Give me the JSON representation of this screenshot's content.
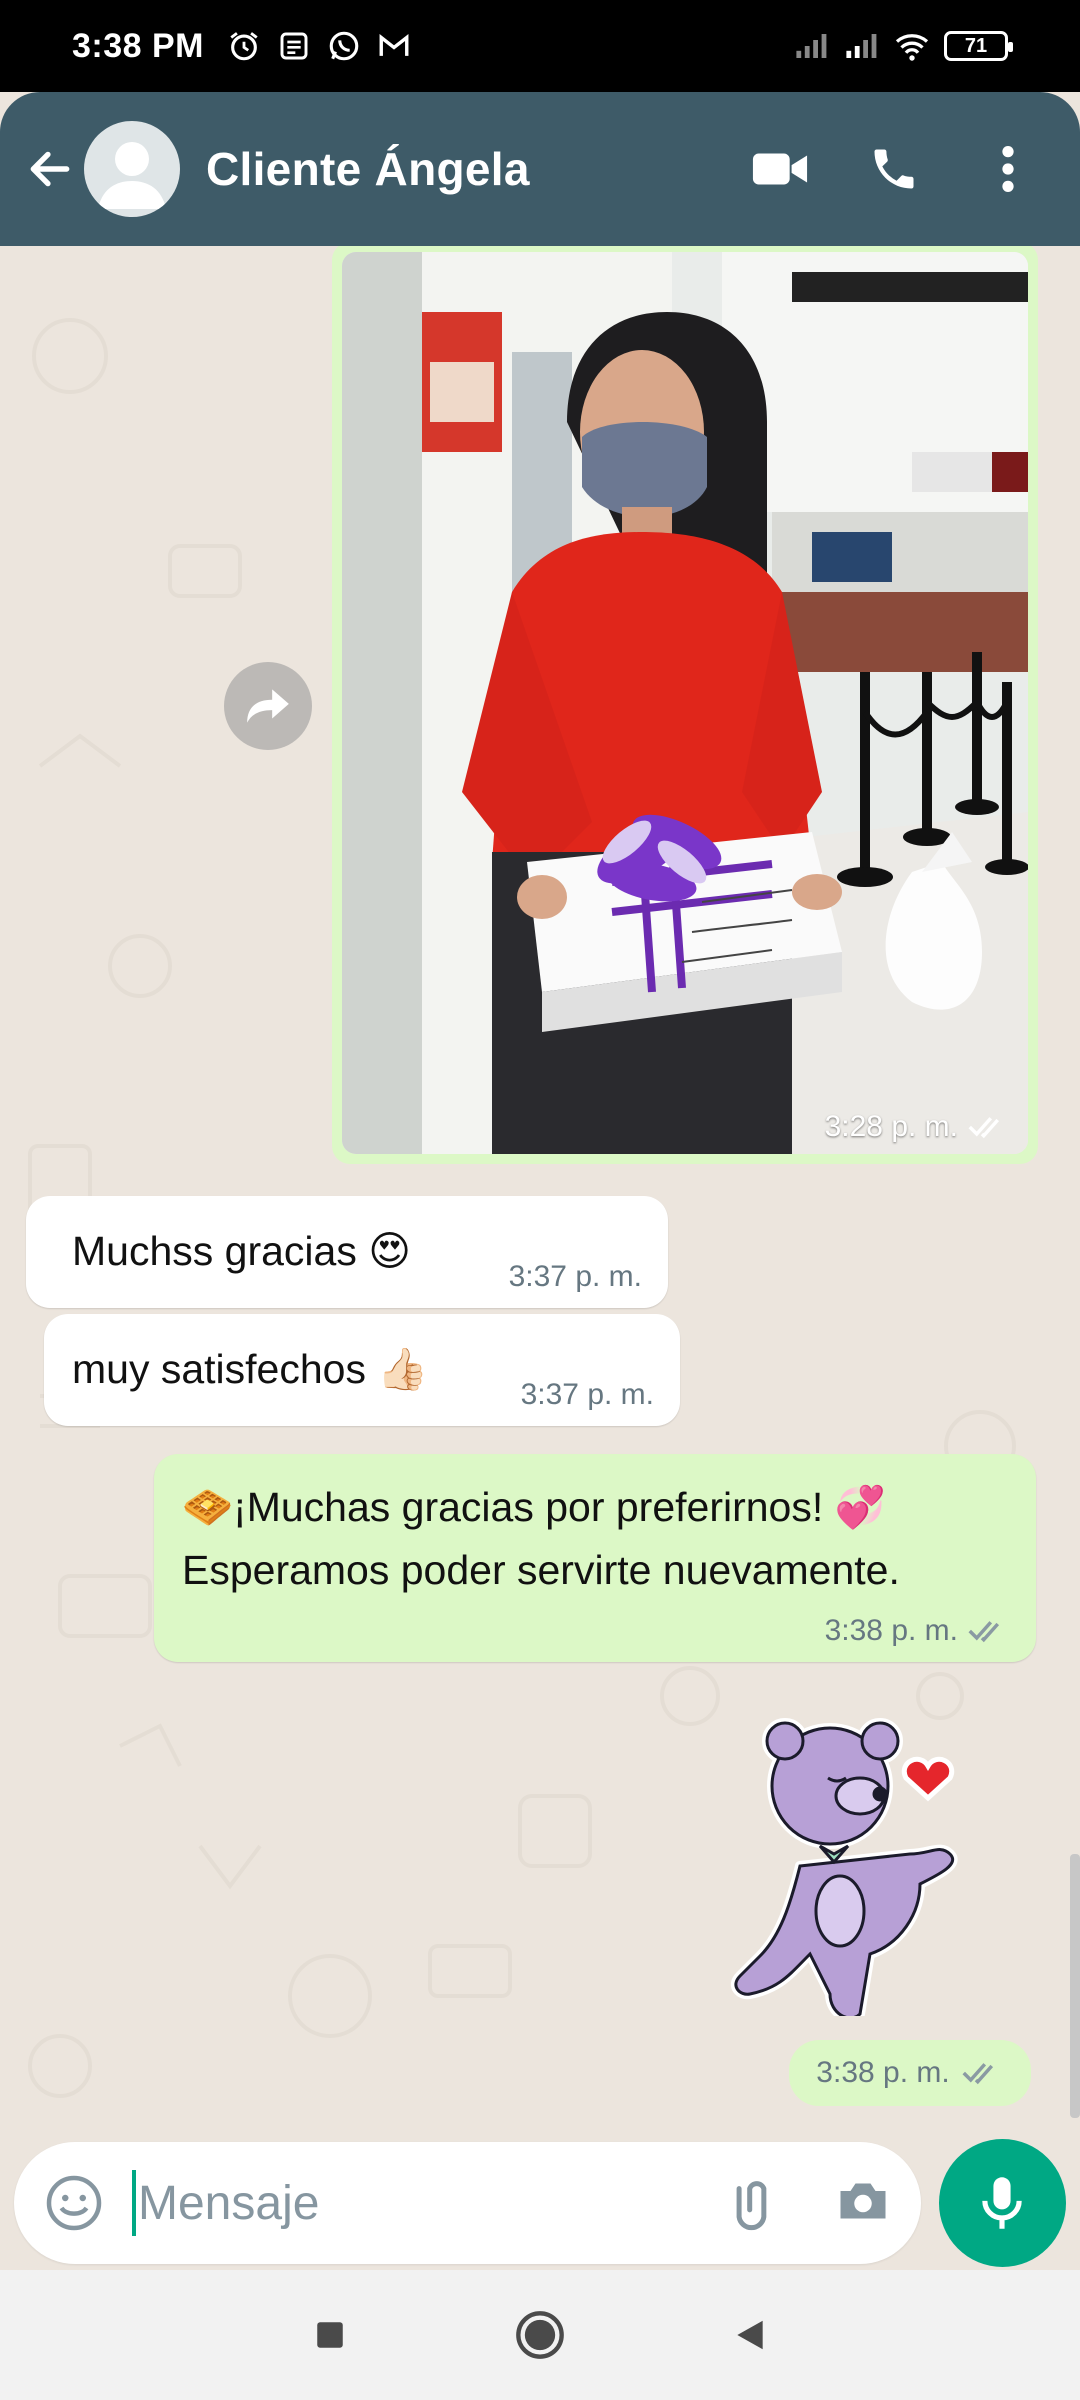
{
  "status_bar": {
    "time": "3:38 PM",
    "battery": "71",
    "left_icons": [
      "alarm-icon",
      "notification-icon",
      "whatsapp-icon",
      "gmail-icon"
    ],
    "right_icons": [
      "signal-icon",
      "signal-icon",
      "wifi-icon",
      "battery-icon"
    ]
  },
  "header": {
    "contact_name": "Cliente Ángela",
    "icons": [
      "back-arrow-icon",
      "avatar",
      "video-call-icon",
      "phone-call-icon",
      "more-vert-icon"
    ]
  },
  "messages": [
    {
      "type": "image",
      "direction": "out",
      "time": "3:28 p. m.",
      "status": "read"
    },
    {
      "type": "text",
      "direction": "in",
      "text": "Muchss gracias 😍",
      "time": "3:37 p. m."
    },
    {
      "type": "text",
      "direction": "in",
      "text": "muy satisfechos 👍🏻",
      "time": "3:37 p. m."
    },
    {
      "type": "text",
      "direction": "out",
      "line1": "🧇¡Muchas gracias por preferirnos! 💞",
      "line2": "Esperamos poder servirte nuevamente.",
      "time": "3:38 p. m.",
      "status": "read"
    },
    {
      "type": "sticker",
      "direction": "out",
      "time": "3:38 p. m.",
      "status": "read"
    }
  ],
  "input": {
    "placeholder": "Mensaje",
    "icons": [
      "emoji-icon",
      "attach-icon",
      "camera-icon",
      "mic-icon"
    ]
  },
  "nav": {
    "icons": [
      "recents-icon",
      "home-icon",
      "back-icon"
    ]
  },
  "colors": {
    "header": "#3e5b68",
    "chat_bg": "#ece5dd",
    "outgoing_bubble": "#dcf8c6",
    "incoming_bubble": "#ffffff",
    "accent": "#00a884",
    "read_ticks": "#667781"
  }
}
